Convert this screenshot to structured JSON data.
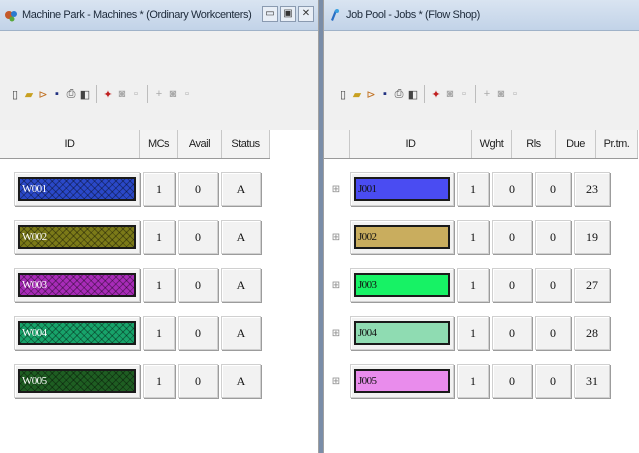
{
  "left": {
    "title": "Machine Park - Machines * (Ordinary Workcenters)",
    "window_buttons": [
      "▭",
      "▣",
      "✕"
    ],
    "columns": [
      "ID",
      "MCs",
      "Avail",
      "Status"
    ],
    "rows": [
      {
        "id": "W001",
        "color": "#2a48c8",
        "mcs": "1",
        "avail": "0",
        "status": "A"
      },
      {
        "id": "W002",
        "color": "#7b7a18",
        "mcs": "1",
        "avail": "0",
        "status": "A"
      },
      {
        "id": "W003",
        "color": "#a82bb8",
        "mcs": "1",
        "avail": "0",
        "status": "A"
      },
      {
        "id": "W004",
        "color": "#17a36a",
        "mcs": "1",
        "avail": "0",
        "status": "A"
      },
      {
        "id": "W005",
        "color": "#1e5e22",
        "mcs": "1",
        "avail": "0",
        "status": "A"
      }
    ]
  },
  "right": {
    "title": "Job Pool - Jobs * (Flow Shop)",
    "columns": [
      "ID",
      "Wght",
      "Rls",
      "Due",
      "Pr.tm."
    ],
    "rows": [
      {
        "id": "J001",
        "color": "#4a4cf2",
        "wght": "1",
        "rls": "0",
        "due": "0",
        "prtm": "23"
      },
      {
        "id": "J002",
        "color": "#c9ad5e",
        "wght": "1",
        "rls": "0",
        "due": "0",
        "prtm": "19"
      },
      {
        "id": "J003",
        "color": "#17f265",
        "wght": "1",
        "rls": "0",
        "due": "0",
        "prtm": "27"
      },
      {
        "id": "J004",
        "color": "#8fdcb2",
        "wght": "1",
        "rls": "0",
        "due": "0",
        "prtm": "28"
      },
      {
        "id": "J005",
        "color": "#e98cec",
        "wght": "1",
        "rls": "0",
        "due": "0",
        "prtm": "31"
      }
    ]
  },
  "toolbar_icons": [
    "new-icon",
    "open-icon",
    "import-icon",
    "save-icon",
    "print-icon",
    "preview-icon",
    "insert-icon",
    "delete-icon",
    "edit-icon",
    "add-icon",
    "remove-icon",
    "move-icon"
  ]
}
